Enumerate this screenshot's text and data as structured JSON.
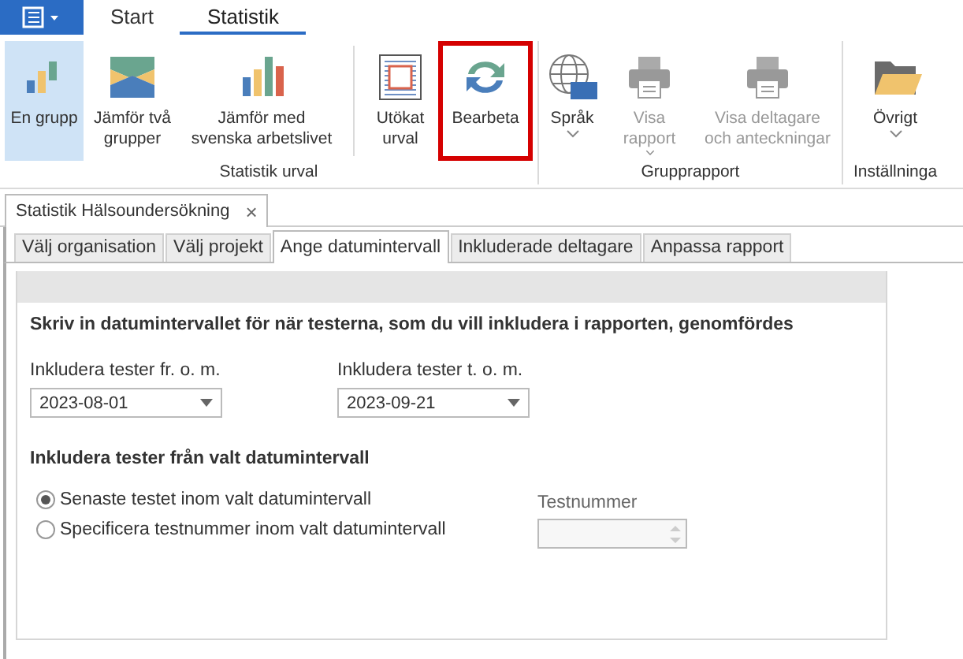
{
  "menu_tabs": [
    {
      "label": "Start",
      "selected": false
    },
    {
      "label": "Statistik",
      "selected": true
    }
  ],
  "ribbon_groups": [
    {
      "label": "Statistik urval",
      "button_sets": [
        [
          {
            "label": "En grupp",
            "selected": true,
            "disabled": false,
            "highlighted": false,
            "dropdown": false
          },
          {
            "label": "Jämför två grupper",
            "selected": false,
            "disabled": false,
            "highlighted": false,
            "dropdown": false
          },
          {
            "label": "Jämför med svenska arbetslivet",
            "selected": false,
            "disabled": false,
            "highlighted": false,
            "dropdown": false
          }
        ],
        [
          {
            "label": "Utökat urval",
            "selected": false,
            "disabled": false,
            "highlighted": false,
            "dropdown": false
          },
          {
            "label": "Bearbeta",
            "selected": false,
            "disabled": false,
            "highlighted": true,
            "dropdown": false
          }
        ]
      ]
    },
    {
      "label": "Grupprapport",
      "button_sets": [
        [
          {
            "label": "Språk",
            "selected": false,
            "disabled": false,
            "highlighted": false,
            "dropdown": true
          },
          {
            "label": "Visa rapport",
            "selected": false,
            "disabled": true,
            "highlighted": false,
            "dropdown": true
          },
          {
            "label": "Visa deltagare och anteckningar",
            "selected": false,
            "disabled": true,
            "highlighted": false,
            "dropdown": false
          }
        ]
      ]
    },
    {
      "label": "Inställninga",
      "button_sets": [
        [
          {
            "label": "Övrigt",
            "selected": false,
            "disabled": false,
            "highlighted": false,
            "dropdown": true
          }
        ]
      ]
    }
  ],
  "document_tab": {
    "title": "Statistik Hälsoundersökning",
    "close": "×"
  },
  "tabs": [
    {
      "label": "Välj organisation",
      "selected": false
    },
    {
      "label": "Välj projekt",
      "selected": false
    },
    {
      "label": "Ange datumintervall",
      "selected": true
    },
    {
      "label": "Inkluderade deltagare",
      "selected": false
    },
    {
      "label": "Anpassa rapport",
      "selected": false
    }
  ],
  "heading": "Skriv in datumintervallet för när testerna, som du vill inkludera i rapporten, genomfördes",
  "date_fields": [
    {
      "label": "Inkludera tester fr. o. m.",
      "value": "2023-08-01"
    },
    {
      "label": "Inkludera tester t. o. m.",
      "value": "2023-09-21"
    }
  ],
  "section_heading": "Inkludera tester från valt datumintervall",
  "radio_options": [
    {
      "label": "Senaste testet inom valt datumintervall",
      "selected": true
    },
    {
      "label": "Specificera testnummer inom valt datumintervall",
      "selected": false
    }
  ],
  "test_number": {
    "label": "Testnummer",
    "disabled": true
  }
}
